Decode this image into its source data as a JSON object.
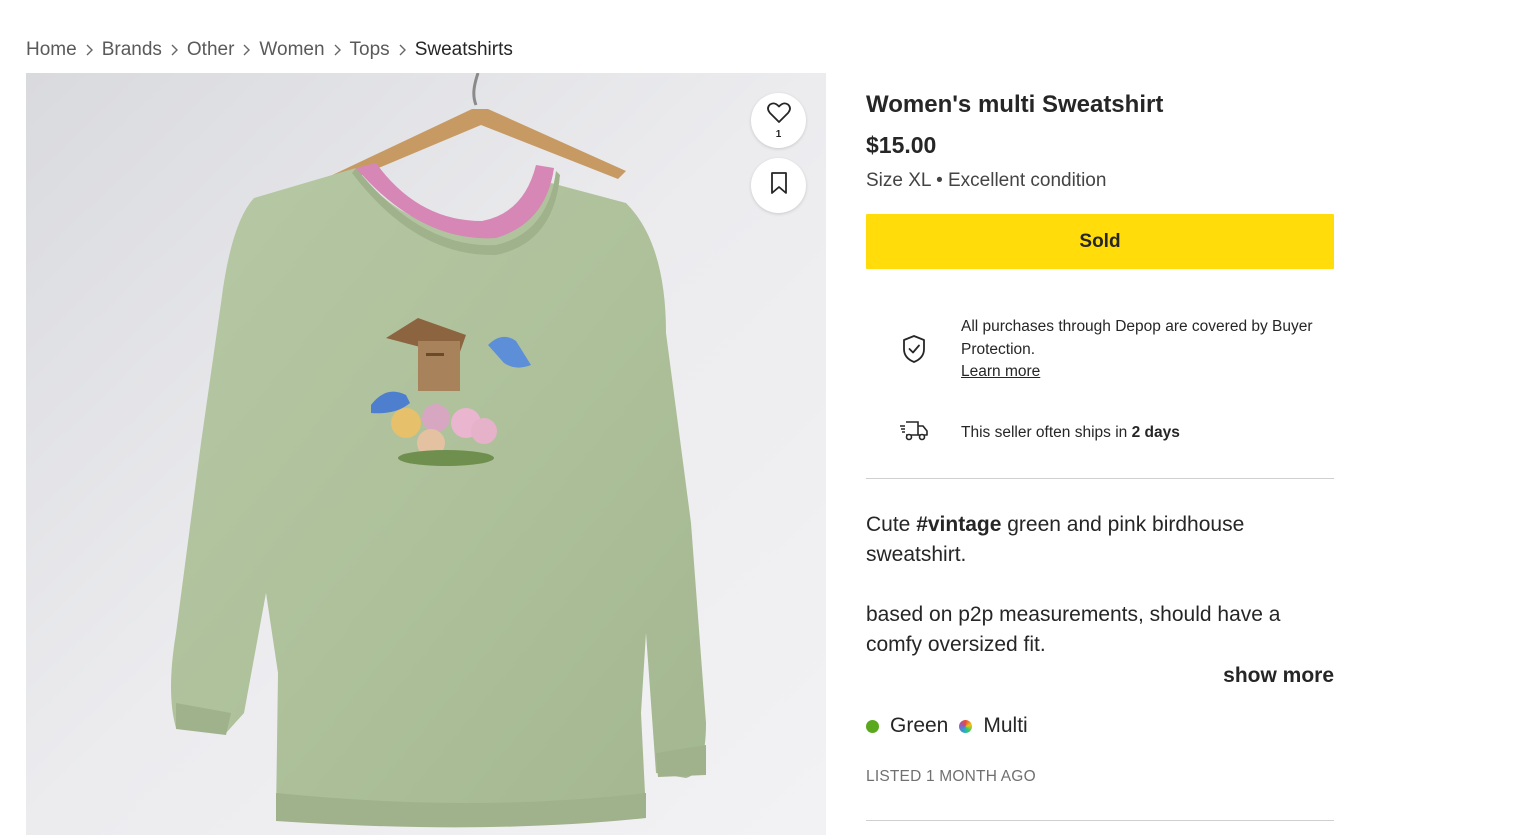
{
  "breadcrumb": {
    "items": [
      "Home",
      "Brands",
      "Other",
      "Women",
      "Tops",
      "Sweatshirts"
    ]
  },
  "product": {
    "title": "Women's multi Sweatshirt",
    "price": "$15.00",
    "size": "Size XL",
    "bullet": "•",
    "condition": "Excellent condition",
    "sold_label": "Sold",
    "like_count": "1"
  },
  "protection": {
    "text": "All purchases through Depop are covered by Buyer Protection.",
    "link": "Learn more"
  },
  "shipping": {
    "prefix": "This seller often ships in",
    "days": "2 days"
  },
  "description": {
    "p1_before": "Cute",
    "p1_tag": "#vintage",
    "p1_after": "green and pink birdhouse sweatshirt.",
    "p2": "based on p2p measurements, should have a comfy oversized fit.",
    "show_more": "show more"
  },
  "colors": [
    {
      "name": "Green",
      "swatch": "#5aa81e"
    },
    {
      "name": "Multi",
      "swatch": "multicolor"
    }
  ],
  "listed": "LISTED 1 MONTH AGO",
  "icons": {
    "like": "heart-icon",
    "save": "bookmark-icon",
    "protection": "shield-check-icon",
    "shipping": "delivery-truck-icon",
    "separator": "chevron-right-icon"
  },
  "accent": {
    "sold_button": "#ffdc0a"
  }
}
